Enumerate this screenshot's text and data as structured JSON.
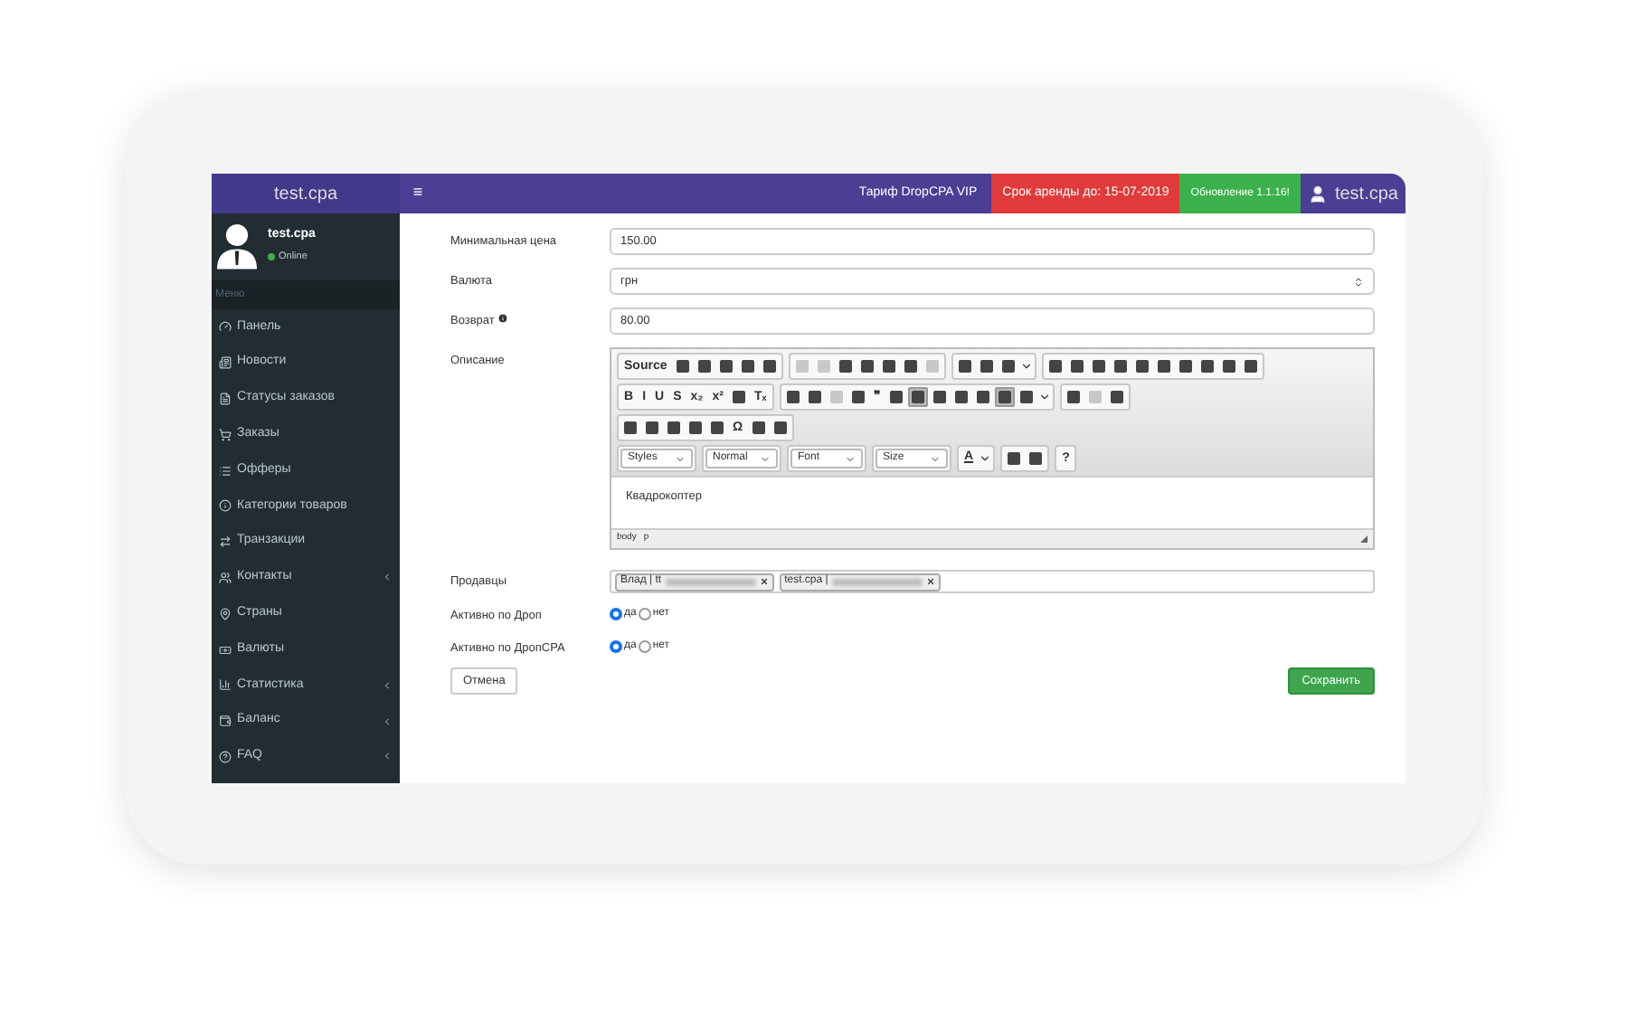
{
  "header": {
    "logo": "test.cpa",
    "menu_icon": "≡",
    "plan": "Тариф DropCPA VIP",
    "lease": "Срок аренды до: 15-07-2019",
    "update": "Обновление 1.1.16!",
    "user": "test.cpa"
  },
  "sidebar": {
    "user": {
      "name": "test.cpa",
      "status": "Online"
    },
    "section": "Меню",
    "items": [
      {
        "label": "Панель",
        "has_submenu": false
      },
      {
        "label": "Новости",
        "has_submenu": false
      },
      {
        "label": "Статусы заказов",
        "has_submenu": false
      },
      {
        "label": "Заказы",
        "has_submenu": false
      },
      {
        "label": "Офферы",
        "has_submenu": false
      },
      {
        "label": "Категории товаров",
        "has_submenu": false
      },
      {
        "label": "Транзакции",
        "has_submenu": false
      },
      {
        "label": "Контакты",
        "has_submenu": true
      },
      {
        "label": "Страны",
        "has_submenu": false
      },
      {
        "label": "Валюты",
        "has_submenu": false
      },
      {
        "label": "Статистика",
        "has_submenu": true
      },
      {
        "label": "Баланс",
        "has_submenu": true
      },
      {
        "label": "FAQ",
        "has_submenu": true
      }
    ]
  },
  "form": {
    "fields": [
      {
        "kind": "input",
        "label": "Минимальная цена",
        "value": "150.00"
      },
      {
        "kind": "select",
        "label": "Валюта",
        "value": "грн"
      },
      {
        "kind": "input",
        "label": "Возврат",
        "value": "80.00",
        "info": true
      }
    ],
    "editor": {
      "label": "Описание",
      "toolbar_rows": [
        [
          [
            {
              "kind": "text",
              "label": "Source"
            },
            {
              "kind": "icon"
            },
            {
              "kind": "icon"
            },
            {
              "kind": "icon"
            },
            {
              "kind": "icon"
            },
            {
              "kind": "icon"
            }
          ],
          [
            {
              "kind": "icon",
              "disabled": true
            },
            {
              "kind": "icon",
              "disabled": true
            },
            {
              "kind": "icon"
            },
            {
              "kind": "icon"
            },
            {
              "kind": "icon"
            },
            {
              "kind": "icon"
            },
            {
              "kind": "icon",
              "disabled": true
            }
          ],
          [
            {
              "kind": "icon"
            },
            {
              "kind": "icon"
            },
            {
              "kind": "icon"
            },
            {
              "kind": "dropdown"
            }
          ],
          [
            {
              "kind": "icon"
            },
            {
              "kind": "icon"
            },
            {
              "kind": "icon"
            },
            {
              "kind": "icon"
            },
            {
              "kind": "icon"
            },
            {
              "kind": "icon"
            },
            {
              "kind": "icon"
            },
            {
              "kind": "icon"
            },
            {
              "kind": "icon"
            },
            {
              "kind": "icon"
            }
          ]
        ],
        [
          [
            {
              "kind": "text",
              "label": "B"
            },
            {
              "kind": "text",
              "label": "I"
            },
            {
              "kind": "text",
              "label": "U"
            },
            {
              "kind": "text",
              "label": "S"
            },
            {
              "kind": "text",
              "label": "x₂"
            },
            {
              "kind": "text",
              "label": "x²"
            },
            {
              "kind": "icon"
            },
            {
              "kind": "text",
              "label": "Tₓ"
            }
          ],
          [
            {
              "kind": "icon"
            },
            {
              "kind": "icon"
            },
            {
              "kind": "icon",
              "disabled": true
            },
            {
              "kind": "icon"
            },
            {
              "kind": "text",
              "label": "❞"
            },
            {
              "kind": "icon"
            },
            {
              "kind": "icon",
              "selected": true
            },
            {
              "kind": "icon"
            },
            {
              "kind": "icon"
            },
            {
              "kind": "icon"
            },
            {
              "kind": "icon",
              "selected": true
            },
            {
              "kind": "icon"
            },
            {
              "kind": "dropdown"
            }
          ],
          [
            {
              "kind": "icon"
            },
            {
              "kind": "icon",
              "disabled": true
            },
            {
              "kind": "icon"
            }
          ]
        ],
        [
          [
            {
              "kind": "icon"
            },
            {
              "kind": "icon"
            },
            {
              "kind": "icon"
            },
            {
              "kind": "icon"
            },
            {
              "kind": "icon"
            },
            {
              "kind": "text",
              "label": "Ω"
            },
            {
              "kind": "icon"
            },
            {
              "kind": "icon"
            }
          ]
        ],
        [
          [
            {
              "kind": "combo",
              "label": "Styles"
            }
          ],
          [
            {
              "kind": "combo",
              "label": "Normal"
            }
          ],
          [
            {
              "kind": "combo",
              "label": "Font"
            }
          ],
          [
            {
              "kind": "combo",
              "label": "Size"
            }
          ],
          [
            {
              "kind": "textdrop",
              "label": "A"
            },
            {
              "kind": "dropdown"
            }
          ],
          [
            {
              "kind": "icon"
            },
            {
              "kind": "icon"
            }
          ],
          [
            {
              "kind": "text",
              "label": "?"
            }
          ]
        ]
      ],
      "content": "Квадрокоптер",
      "path": [
        "body",
        "p"
      ]
    },
    "sellers": {
      "label": "Продавцы",
      "tags": [
        {
          "text": "Влад | tt"
        },
        {
          "text": "test.cpa | "
        }
      ]
    },
    "radios": [
      {
        "label": "Активно по Дроп",
        "options": [
          {
            "label": "да",
            "selected": true
          },
          {
            "label": "нет",
            "selected": false
          }
        ]
      },
      {
        "label": "Активно по ДропCPA",
        "options": [
          {
            "label": "да",
            "selected": true
          },
          {
            "label": "нет",
            "selected": false
          }
        ]
      }
    ],
    "cancel": "Отмена",
    "save": "Сохранить"
  }
}
